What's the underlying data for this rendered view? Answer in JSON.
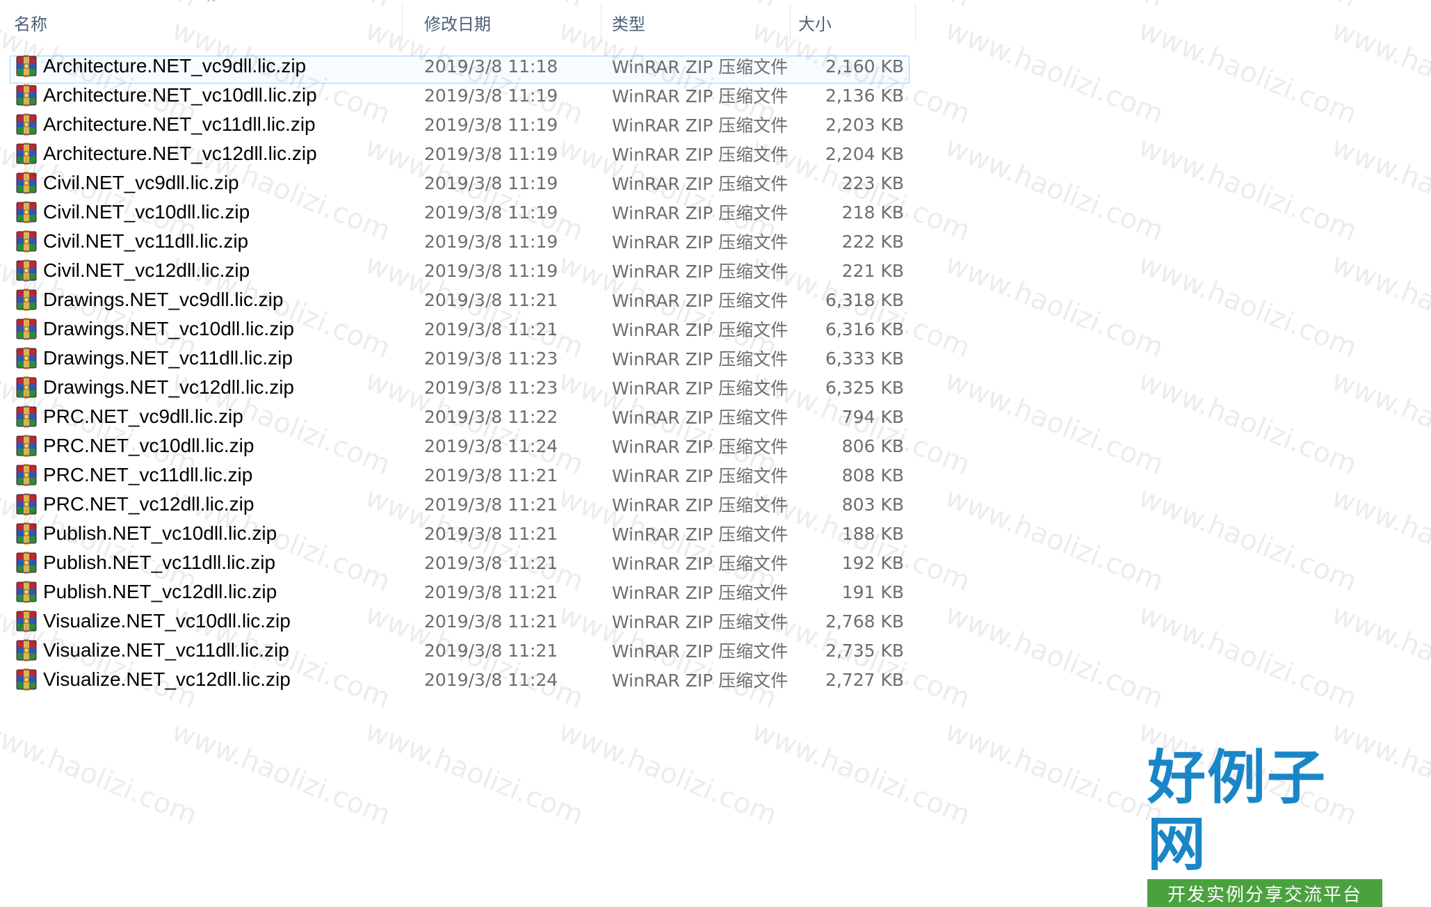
{
  "columns": {
    "name": "名称",
    "date": "修改日期",
    "type": "类型",
    "size": "大小"
  },
  "selected_index": 0,
  "files": [
    {
      "name": "Architecture.NET_vc9dll.lic.zip",
      "date": "2019/3/8 11:18",
      "type": "WinRAR ZIP 压缩文件",
      "size": "2,160 KB"
    },
    {
      "name": "Architecture.NET_vc10dll.lic.zip",
      "date": "2019/3/8 11:19",
      "type": "WinRAR ZIP 压缩文件",
      "size": "2,136 KB"
    },
    {
      "name": "Architecture.NET_vc11dll.lic.zip",
      "date": "2019/3/8 11:19",
      "type": "WinRAR ZIP 压缩文件",
      "size": "2,203 KB"
    },
    {
      "name": "Architecture.NET_vc12dll.lic.zip",
      "date": "2019/3/8 11:19",
      "type": "WinRAR ZIP 压缩文件",
      "size": "2,204 KB"
    },
    {
      "name": "Civil.NET_vc9dll.lic.zip",
      "date": "2019/3/8 11:19",
      "type": "WinRAR ZIP 压缩文件",
      "size": "223 KB"
    },
    {
      "name": "Civil.NET_vc10dll.lic.zip",
      "date": "2019/3/8 11:19",
      "type": "WinRAR ZIP 压缩文件",
      "size": "218 KB"
    },
    {
      "name": "Civil.NET_vc11dll.lic.zip",
      "date": "2019/3/8 11:19",
      "type": "WinRAR ZIP 压缩文件",
      "size": "222 KB"
    },
    {
      "name": "Civil.NET_vc12dll.lic.zip",
      "date": "2019/3/8 11:19",
      "type": "WinRAR ZIP 压缩文件",
      "size": "221 KB"
    },
    {
      "name": "Drawings.NET_vc9dll.lic.zip",
      "date": "2019/3/8 11:21",
      "type": "WinRAR ZIP 压缩文件",
      "size": "6,318 KB"
    },
    {
      "name": "Drawings.NET_vc10dll.lic.zip",
      "date": "2019/3/8 11:21",
      "type": "WinRAR ZIP 压缩文件",
      "size": "6,316 KB"
    },
    {
      "name": "Drawings.NET_vc11dll.lic.zip",
      "date": "2019/3/8 11:23",
      "type": "WinRAR ZIP 压缩文件",
      "size": "6,333 KB"
    },
    {
      "name": "Drawings.NET_vc12dll.lic.zip",
      "date": "2019/3/8 11:23",
      "type": "WinRAR ZIP 压缩文件",
      "size": "6,325 KB"
    },
    {
      "name": "PRC.NET_vc9dll.lic.zip",
      "date": "2019/3/8 11:22",
      "type": "WinRAR ZIP 压缩文件",
      "size": "794 KB"
    },
    {
      "name": "PRC.NET_vc10dll.lic.zip",
      "date": "2019/3/8 11:24",
      "type": "WinRAR ZIP 压缩文件",
      "size": "806 KB"
    },
    {
      "name": "PRC.NET_vc11dll.lic.zip",
      "date": "2019/3/8 11:21",
      "type": "WinRAR ZIP 压缩文件",
      "size": "808 KB"
    },
    {
      "name": "PRC.NET_vc12dll.lic.zip",
      "date": "2019/3/8 11:21",
      "type": "WinRAR ZIP 压缩文件",
      "size": "803 KB"
    },
    {
      "name": "Publish.NET_vc10dll.lic.zip",
      "date": "2019/3/8 11:21",
      "type": "WinRAR ZIP 压缩文件",
      "size": "188 KB"
    },
    {
      "name": "Publish.NET_vc11dll.lic.zip",
      "date": "2019/3/8 11:21",
      "type": "WinRAR ZIP 压缩文件",
      "size": "192 KB"
    },
    {
      "name": "Publish.NET_vc12dll.lic.zip",
      "date": "2019/3/8 11:21",
      "type": "WinRAR ZIP 压缩文件",
      "size": "191 KB"
    },
    {
      "name": "Visualize.NET_vc10dll.lic.zip",
      "date": "2019/3/8 11:21",
      "type": "WinRAR ZIP 压缩文件",
      "size": "2,768 KB"
    },
    {
      "name": "Visualize.NET_vc11dll.lic.zip",
      "date": "2019/3/8 11:21",
      "type": "WinRAR ZIP 压缩文件",
      "size": "2,735 KB"
    },
    {
      "name": "Visualize.NET_vc12dll.lic.zip",
      "date": "2019/3/8 11:24",
      "type": "WinRAR ZIP 压缩文件",
      "size": "2,727 KB"
    }
  ],
  "file_icon": "winrar-archive-icon",
  "watermark": "www.haolizi.com",
  "logo": {
    "main": "好例子网",
    "sub": "开发实例分享交流平台"
  },
  "colors": {
    "header_text": "#4c607a",
    "secondary_text": "#6d6d6d",
    "selection_border": "#99d1ff",
    "logo_blue": "#1a86c8",
    "logo_green": "#4aa23f"
  }
}
